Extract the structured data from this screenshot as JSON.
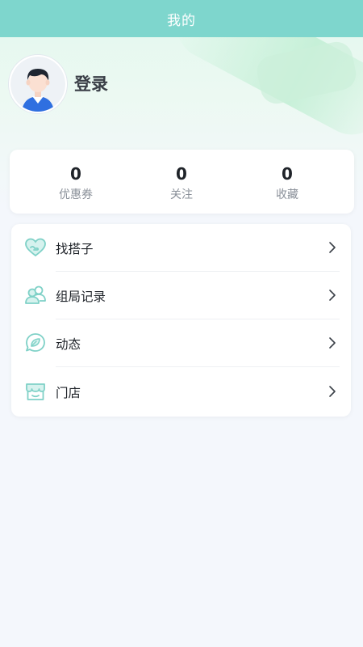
{
  "header": {
    "title": "我的"
  },
  "profile": {
    "login_label": "登录"
  },
  "stats": [
    {
      "count": "0",
      "label": "优惠券"
    },
    {
      "count": "0",
      "label": "关注"
    },
    {
      "count": "0",
      "label": "收藏"
    }
  ],
  "menu": [
    {
      "label": "找搭子",
      "icon": "heart-hand-icon"
    },
    {
      "label": "组局记录",
      "icon": "group-users-icon"
    },
    {
      "label": "动态",
      "icon": "leaf-chat-icon"
    },
    {
      "label": "门店",
      "icon": "store-icon"
    }
  ],
  "colors": {
    "accent": "#7ed6cd",
    "icon": "#7fd1c7"
  }
}
